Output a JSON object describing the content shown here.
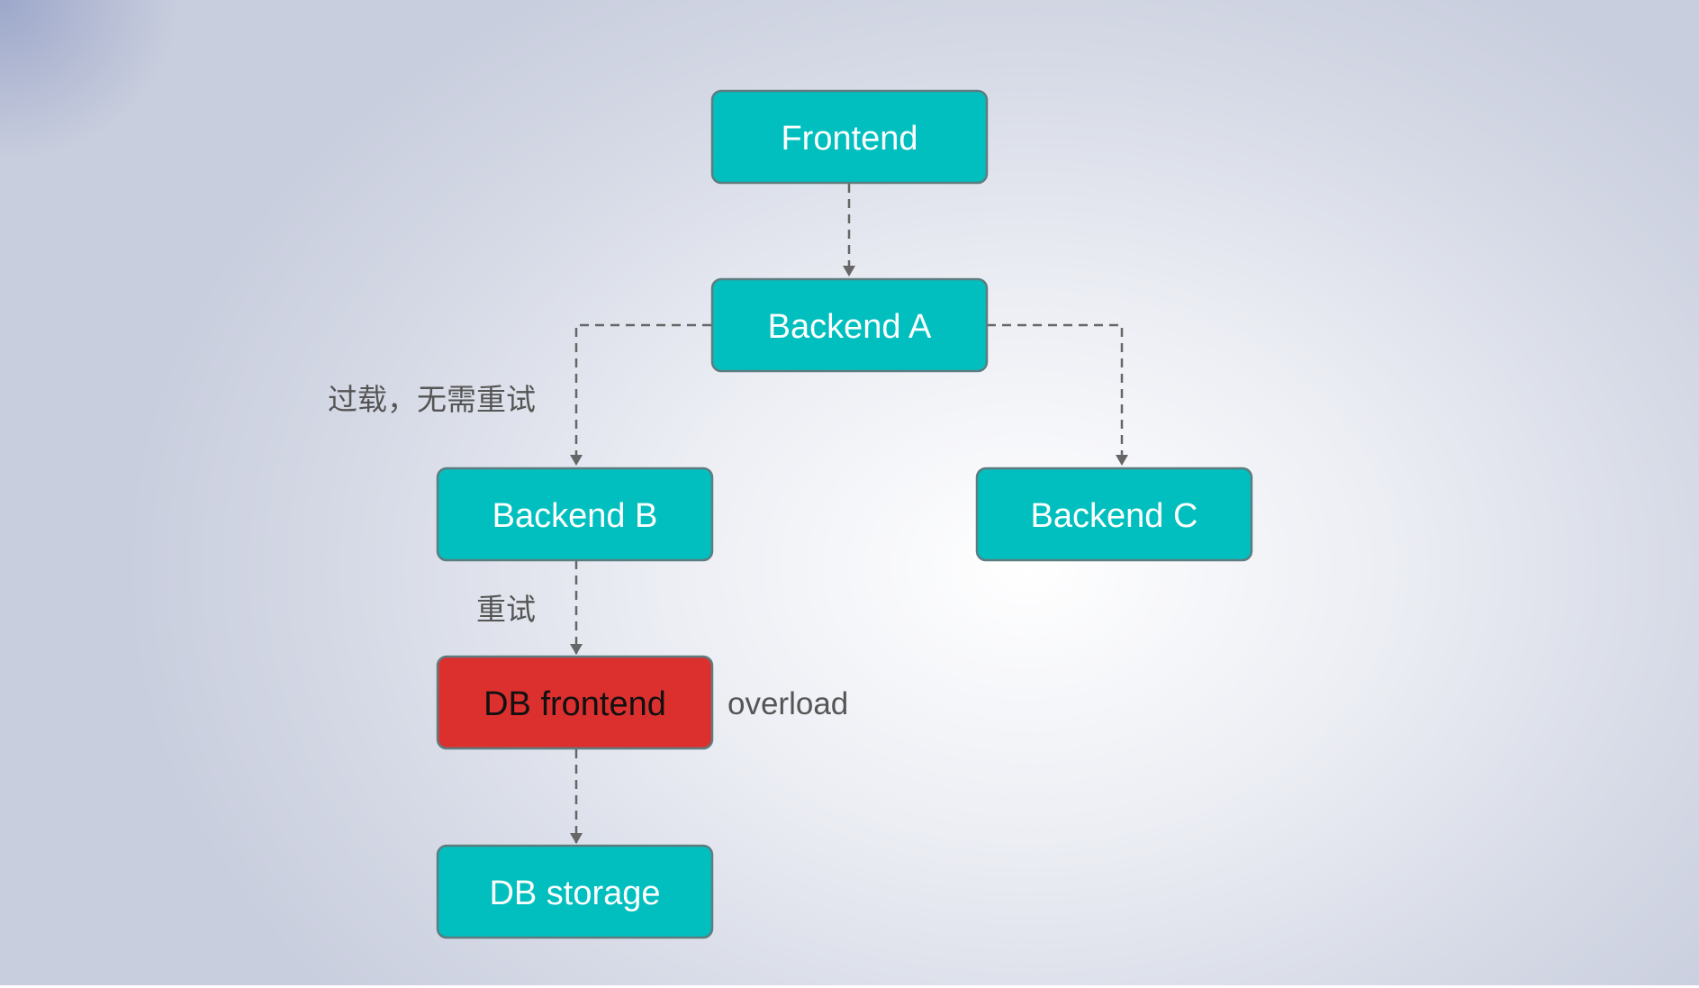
{
  "colors": {
    "node_fill": "#01bfbf",
    "node_stroke": "#5d7c80",
    "overload_fill": "#dc302e",
    "edge_stroke": "#666666",
    "label_text": "#555555"
  },
  "nodes": {
    "frontend": "Frontend",
    "backend_a": "Backend A",
    "backend_b": "Backend B",
    "backend_c": "Backend C",
    "db_frontend": "DB frontend",
    "db_storage": "DB storage"
  },
  "labels": {
    "overload_no_retry": "过载，无需重试",
    "retry": "重试",
    "overload": "overload"
  }
}
